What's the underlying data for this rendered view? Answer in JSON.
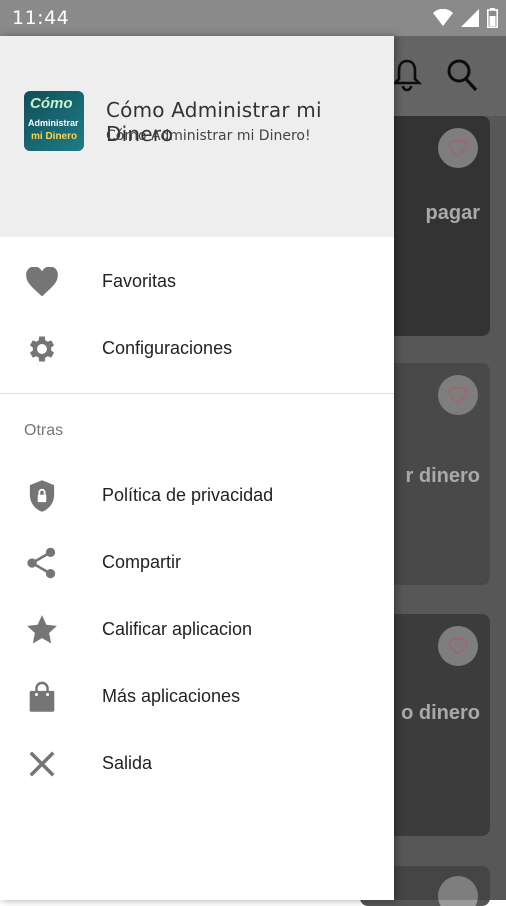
{
  "status_bar": {
    "time": "11:44",
    "icons": [
      "wifi-icon",
      "signal-icon",
      "battery-icon"
    ]
  },
  "background": {
    "toolbar_icons": [
      "bell-icon",
      "search-icon"
    ],
    "cards": [
      {
        "title": "pagar"
      },
      {
        "title": "r dinero"
      },
      {
        "title": "o dinero"
      }
    ]
  },
  "drawer": {
    "header": {
      "logo_text": [
        "Cómo",
        "Administrar",
        "mi Dinero"
      ],
      "title": "Cómo Administrar mi Dinero",
      "subtitle": "Cómo Administrar mi Dinero!"
    },
    "main_items": [
      {
        "label": "Favoritas",
        "icon": "heart-icon"
      },
      {
        "label": "Configuraciones",
        "icon": "gear-icon"
      }
    ],
    "section_label": "Otras",
    "other_items": [
      {
        "label": "Política de privacidad",
        "icon": "shield-lock-icon"
      },
      {
        "label": "Compartir",
        "icon": "share-icon"
      },
      {
        "label": "Calificar aplicacion",
        "icon": "star-icon"
      },
      {
        "label": "Más aplicaciones",
        "icon": "shopping-bag-icon"
      },
      {
        "label": "Salida",
        "icon": "close-icon"
      }
    ]
  },
  "colors": {
    "icon_gray": "#757575",
    "header_bg": "#eeeeee",
    "status_bar": "#8a8a8a"
  }
}
